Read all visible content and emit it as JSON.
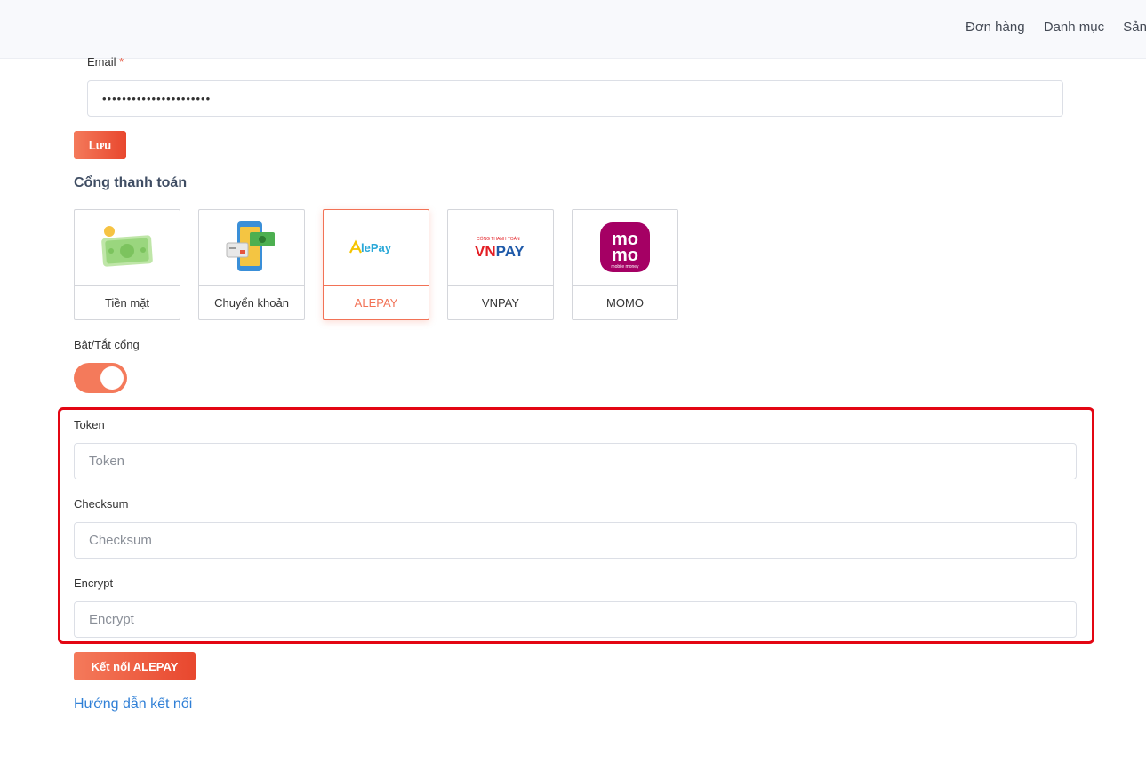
{
  "topnav": {
    "items": [
      "Đơn hàng",
      "Danh mục",
      "Sản"
    ]
  },
  "form": {
    "email_label": "Email",
    "required_mark": "*",
    "email_value": "••••••••••••••••••••••",
    "save_label": "Lưu"
  },
  "gateways": {
    "title": "Cổng thanh toán",
    "items": [
      {
        "label": "Tiền mặt",
        "icon": "cash-icon",
        "active": false
      },
      {
        "label": "Chuyển khoản",
        "icon": "bank-transfer-icon",
        "active": false
      },
      {
        "label": "ALEPAY",
        "icon": "alepay-logo",
        "logo_text": "lePay",
        "active": true
      },
      {
        "label": "VNPAY",
        "icon": "vnpay-logo",
        "logo_small": "CỔNG THANH TOÁN",
        "logo_main": "VNPAY",
        "active": false
      },
      {
        "label": "MOMO",
        "icon": "momo-logo",
        "logo_text": "mo",
        "logo_sub": "mobile money",
        "active": false
      }
    ]
  },
  "toggle": {
    "label": "Bật/Tắt cổng",
    "on": true
  },
  "fields": {
    "token": {
      "label": "Token",
      "placeholder": "Token"
    },
    "checksum": {
      "label": "Checksum",
      "placeholder": "Checksum"
    },
    "encrypt": {
      "label": "Encrypt",
      "placeholder": "Encrypt"
    }
  },
  "connect_label": "Kết nối ALEPAY",
  "help_link": "Hướng dẫn kết nối",
  "colors": {
    "accent": "#f27256",
    "highlight_border": "#e30613",
    "link": "#2f7fd6",
    "momo": "#a50064",
    "vnpay_red": "#e31e24",
    "vnpay_blue": "#1f5aa9",
    "alepay_text": "#2aa8d8",
    "alepay_mark": "#f5c400"
  }
}
